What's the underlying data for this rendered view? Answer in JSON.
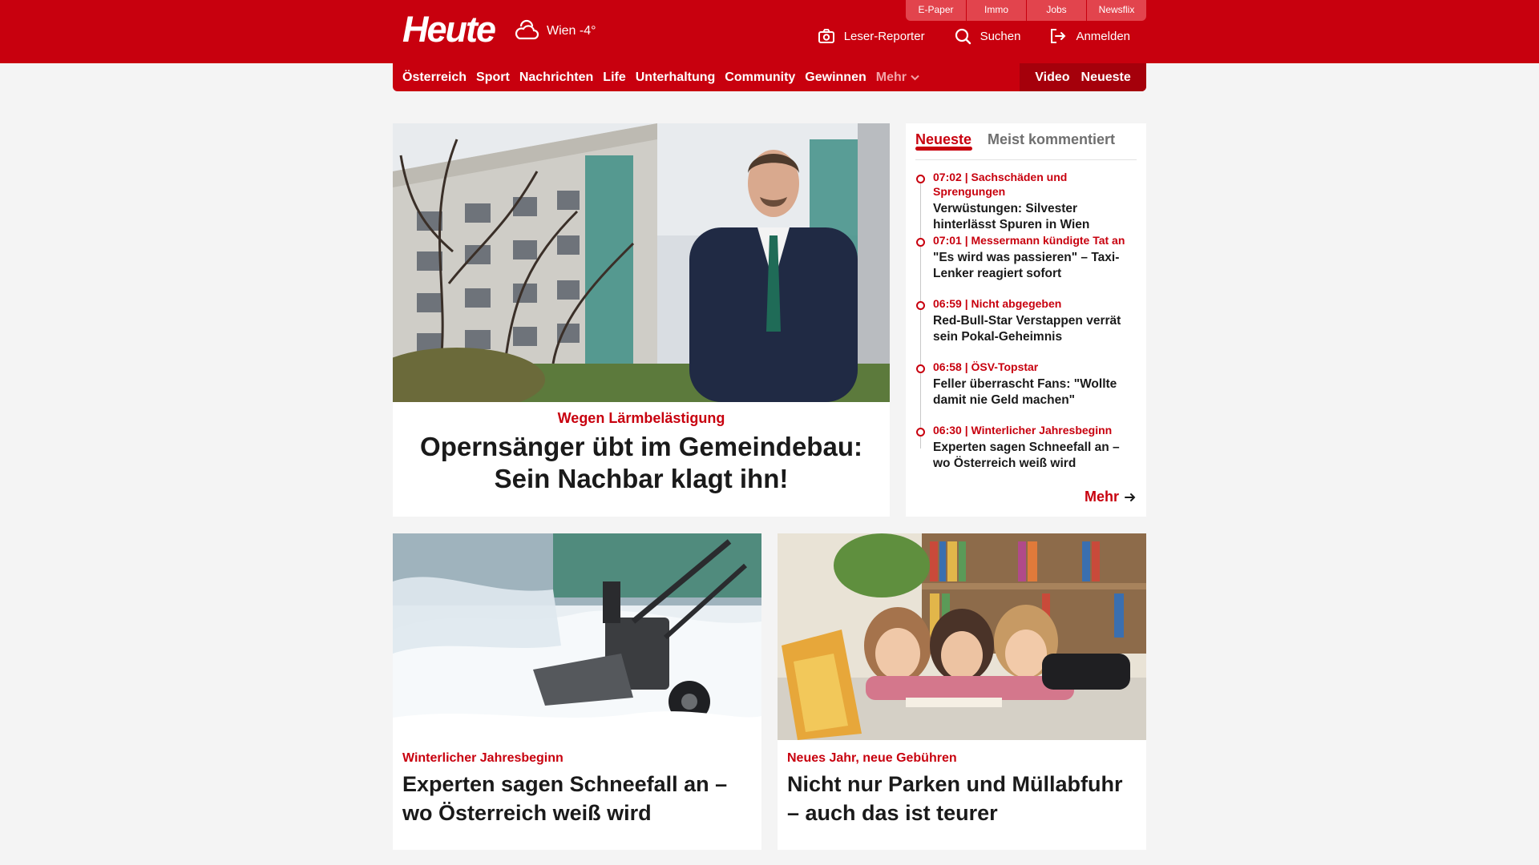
{
  "header": {
    "logo": "Heute",
    "weather": "Wien -4°",
    "top_links": [
      "E-Paper",
      "Immo",
      "Jobs",
      "Newsflix"
    ],
    "actions": {
      "reporter": "Leser-Reporter",
      "search": "Suchen",
      "login": "Anmelden"
    }
  },
  "nav": {
    "items": [
      "Österreich",
      "Sport",
      "Nachrichten",
      "Life",
      "Unterhaltung",
      "Community",
      "Gewinnen"
    ],
    "more": "Mehr",
    "video": "Video",
    "latest": "Neueste"
  },
  "hero": {
    "kicker": "Wegen Lärmbelästigung",
    "title": "Opernsänger übt im Gemeindebau: Sein Nachbar klagt ihn!"
  },
  "sidebar": {
    "tab_active": "Neueste",
    "tab_inactive": "Meist kommentiert",
    "items": [
      {
        "meta": "07:02 | Sachschäden und Sprengungen",
        "title": "Verwüstungen: Silvester hinterlässt Spuren in Wien"
      },
      {
        "meta": "07:01 | Messermann kündigte Tat an",
        "title": "\"Es wird was passieren\" – Taxi-Lenker reagiert sofort"
      },
      {
        "meta": "06:59 | Nicht abgegeben",
        "title": "Red-Bull-Star Verstappen verrät sein Pokal-Geheimnis"
      },
      {
        "meta": "06:58 | ÖSV-Topstar",
        "title": "Feller überrascht Fans: \"Wollte damit nie Geld machen\""
      },
      {
        "meta": "06:30 | Winterlicher Jahresbeginn",
        "title": "Experten sagen Schneefall an – wo Österreich weiß wird"
      }
    ],
    "more": "Mehr"
  },
  "cards": [
    {
      "kicker": "Winterlicher Jahresbeginn",
      "title": "Experten sagen Schneefall an – wo Österreich weiß wird"
    },
    {
      "kicker": "Neues Jahr, neue Gebühren",
      "title": "Nicht nur Parken und Müllabfuhr – auch das ist teurer"
    }
  ],
  "colors": {
    "brand_red": "#c8000e",
    "nav_dark_red": "#a5000b",
    "top_link_bg": "#e2444d",
    "page_bg": "#f4f4f4"
  }
}
